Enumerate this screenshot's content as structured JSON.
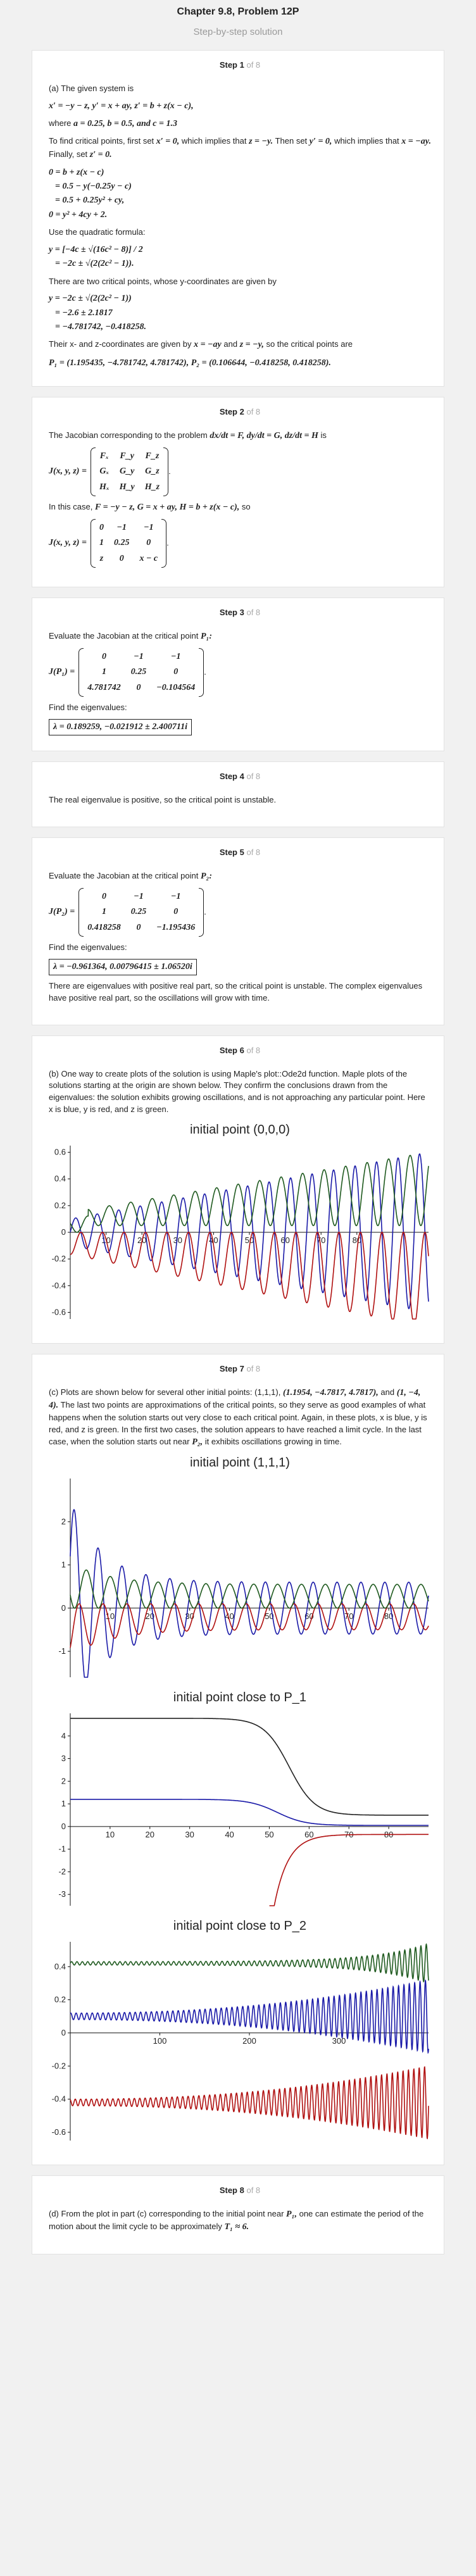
{
  "header": {
    "title": "Chapter 9.8, Problem 12P",
    "subtitle": "Step-by-step solution"
  },
  "steps": [
    {
      "label": "Step 1",
      "of": "of 8",
      "intro": "(a) The given system is",
      "system": "x′ = −y − z,   y′ = x + ay,   z′ = b + z(x − c),",
      "where_label": "where",
      "params": "a = 0.25, b = 0.5, and c = 1.3",
      "crit1": "To find critical points, first set",
      "crit1_eq": "x′ = 0,",
      "crit2": "which implies that",
      "crit2_eq": "z = −y.",
      "crit3": "Then set",
      "crit3_eq": "y′ = 0,",
      "crit4": "which implies that",
      "crit4_eq": "x = −ay.",
      "crit5": "Finally, set",
      "crit5_eq": "z′ = 0.",
      "eq_lines": [
        "0 = b + z(x − c)",
        "= 0.5 − y(−0.25y − c)",
        "= 0.5 + 0.25y² + cy,",
        "0 = y² + 4cy + 2."
      ],
      "quad_text": "Use the quadratic formula:",
      "quad_lines": [
        "y = [−4c ± √(16c² − 8)] / 2",
        "= −2c ± √(2(2c² − 1))."
      ],
      "two_text": "There are two critical points, whose y-coordinates are given by",
      "y_lines": [
        "y = −2c ± √(2(2c² − 1))",
        "= −2.6 ± 2.1817",
        "= −4.781742, −0.418258."
      ],
      "final1": "Their x- and z-coordinates are given by",
      "final1_eq": "x = −ay",
      "final2": "and",
      "final2_eq": "z = −y,",
      "final3": "so the critical points are",
      "points": "P₁ = (1.195435, −4.781742, 4.781742), P₂ = (0.106644, −0.418258, 0.418258)."
    },
    {
      "label": "Step 2",
      "of": "of 8",
      "jac_text": "The Jacobian corresponding to the problem",
      "jac_eq": "dx/dt = F, dy/dt = G,  dz/dt = H",
      "jac_text2": "is",
      "jac_lhs": "J(x, y, z) =",
      "jac_cells": [
        "Fₓ",
        "F_y",
        "F_z",
        "Gₓ",
        "G_y",
        "G_z",
        "Hₓ",
        "H_y",
        "H_z"
      ],
      "case_text": "In this case,",
      "case_eq": "F = −y − z, G = x + ay, H = b + z(x − c),",
      "case_text2": "so",
      "jac2_cells": [
        "0",
        "−1",
        "−1",
        "1",
        "0.25",
        "0",
        "z",
        "0",
        "x − c"
      ]
    },
    {
      "label": "Step 3",
      "of": "of 8",
      "eval_text": "Evaluate the Jacobian at the critical point",
      "eval_pt": "P₁:",
      "lhs": "J(P₁) =",
      "cells": [
        "0",
        "−1",
        "−1",
        "1",
        "0.25",
        "0",
        "4.781742",
        "0",
        "−0.104564"
      ],
      "eig_text": "Find the eigenvalues:",
      "eig": "λ = 0.189259, −0.021912 ± 2.400711i"
    },
    {
      "label": "Step 4",
      "of": "of 8",
      "text": "The real eigenvalue is positive, so the critical point is unstable."
    },
    {
      "label": "Step 5",
      "of": "of 8",
      "eval_text": "Evaluate the Jacobian at the critical point",
      "eval_pt": "P₂:",
      "lhs": "J(P₂) =",
      "cells": [
        "0",
        "−1",
        "−1",
        "1",
        "0.25",
        "0",
        "0.418258",
        "0",
        "−1.195436"
      ],
      "eig_text": "Find the eigenvalues:",
      "eig": "λ = −0.961364, 0.00796415 ± 1.06520i",
      "concl": "There are eigenvalues with positive real part, so the critical point is unstable. The complex eigenvalues have positive real part, so the oscillations will grow with time."
    },
    {
      "label": "Step 6",
      "of": "of 8",
      "text": "(b) One way to create plots of the solution is using Maple's plot::Ode2d function. Maple plots of the solutions starting at the origin are shown below. They confirm the conclusions drawn from the eigenvalues: the solution exhibits growing oscillations, and is not approaching any particular point. Here x is blue, y is red, and z is green."
    },
    {
      "label": "Step 7",
      "of": "of 8",
      "text_a": "(c) Plots are shown below for several other initial points: (1,1,1),",
      "pt_a": "(1.1954, −4.7817, 4.7817),",
      "text_b": "and",
      "pt_b": "(1, −4, 4).",
      "text_c": "The last two points are approximations of the critical points, so they serve as good examples of what happens when the solution starts out very close to each critical point. Again, in these plots, x is blue, y is red, and z is green. In the first two cases, the solution appears to have reached a limit cycle. In the last case, when the solution starts out near",
      "pt_c": "P₂,",
      "text_d": "it exhibits oscillations growing in time."
    },
    {
      "label": "Step 8",
      "of": "of 8",
      "text_a": "(d) From the plot in part (c) corresponding to the initial point near",
      "pt": "P₁,",
      "text_b": "one can estimate the period of the motion about the limit cycle to be approximately",
      "period": "T₁ ≈ 6."
    }
  ],
  "chart_data": [
    {
      "type": "line",
      "title": "initial point (0,0,0)",
      "xlim": [
        0,
        100
      ],
      "ylim": [
        -0.65,
        0.65
      ],
      "xticks": [
        "10",
        "20",
        "30",
        "40",
        "50",
        "60",
        "70",
        "80"
      ],
      "yticks": [
        "0.6",
        "0.4",
        "0.2",
        "0",
        "-0.2",
        "-0.4",
        "-0.6"
      ],
      "series": [
        {
          "color": "#1a1aa8",
          "description": "x(t): oscillation of period about 6, amplitude growing from 0 to about 0.6"
        },
        {
          "color": "#b01010",
          "description": "y(t): oscillation of period about 6 between about -0.6 and 0.1, growing amplitude"
        },
        {
          "color": "#1f5a1f",
          "description": "z(t): oscillation of period about 6 between 0 and about 0.55, growing amplitude"
        }
      ]
    },
    {
      "type": "line",
      "title": "initial point (1,1,1)",
      "xlim": [
        0,
        90
      ],
      "ylim": [
        -1.6,
        3
      ],
      "xticks": [
        "10",
        "20",
        "30",
        "40",
        "50",
        "60",
        "70",
        "80"
      ],
      "yticks": [
        "2",
        "1",
        "0",
        "-1"
      ],
      "series": [
        {
          "color": "#1a1aa8",
          "description": "x(t): decaying oscillation from about 2.5 to a limit cycle amplitude about 0.6"
        },
        {
          "color": "#b01010",
          "description": "y(t): oscillation settling between about -0.6 and 0.1"
        },
        {
          "color": "#1f5a1f",
          "description": "z(t): oscillation settling between 0 and about 0.55"
        }
      ]
    },
    {
      "type": "line",
      "title": "initial point close to P_1",
      "xlim": [
        0,
        90
      ],
      "ylim": [
        -3.5,
        5
      ],
      "xticks": [
        "10",
        "20",
        "30",
        "40",
        "50",
        "60",
        "70",
        "80"
      ],
      "yticks": [
        "4",
        "3",
        "2",
        "1",
        "0",
        "-1",
        "-2",
        "-3"
      ],
      "series": [
        {
          "color": "#222222",
          "description": "z(t): stays near 4.78 until about t = 50, then falls to about 0.5 by t = 65"
        },
        {
          "color": "#1a1aa8",
          "description": "x(t): near 1.2 until about t = 50, then decays to near 0"
        },
        {
          "color": "#b01010",
          "description": "y(t): descends from off-scale near t = 55 up to about -0.3 after t = 65"
        }
      ]
    },
    {
      "type": "line",
      "title": "initial point close to P_2",
      "xlim": [
        0,
        400
      ],
      "ylim": [
        -0.65,
        0.55
      ],
      "xticks": [
        "100",
        "200",
        "300"
      ],
      "yticks": [
        "0.4",
        "0.2",
        "0",
        "-0.2",
        "-0.4",
        "-0.6"
      ],
      "series": [
        {
          "color": "#1f5a1f",
          "description": "z(t): fast oscillation around 0.42 with amplitude growing after t ≈ 300"
        },
        {
          "color": "#1a1aa8",
          "description": "x(t): fast oscillation around 0.1 with amplitude growing with time"
        },
        {
          "color": "#b01010",
          "description": "y(t): fast oscillation around -0.42 with amplitude growing with time"
        }
      ]
    }
  ]
}
